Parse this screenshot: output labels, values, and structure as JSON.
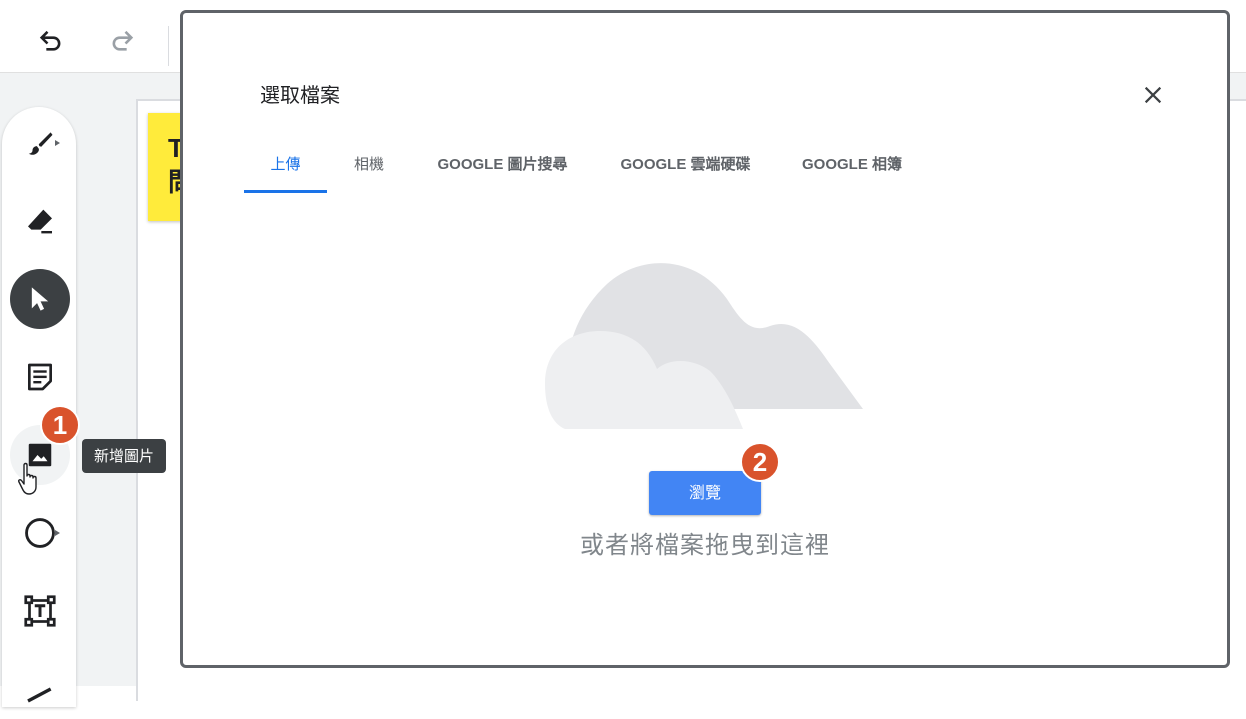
{
  "toolbar": {
    "undo_icon": "undo-icon",
    "redo_icon": "redo-icon"
  },
  "canvas": {
    "sticky_text_line1": "T",
    "sticky_text_line2": "問"
  },
  "tools": [
    {
      "name": "pen-icon"
    },
    {
      "name": "eraser-icon"
    },
    {
      "name": "select-cursor-icon",
      "active": true
    },
    {
      "name": "sticky-note-icon"
    },
    {
      "name": "image-icon"
    },
    {
      "name": "circle-shape-icon"
    },
    {
      "name": "text-box-icon"
    },
    {
      "name": "laser-pointer-icon"
    }
  ],
  "tooltip": {
    "label": "新增圖片"
  },
  "annotations": {
    "step1": "1",
    "step2": "2",
    "color": "#d9532c"
  },
  "dialog": {
    "title": "選取檔案",
    "tabs": [
      {
        "label": "上傳",
        "selected": true
      },
      {
        "label": "相機"
      },
      {
        "label": "GOOGLE 圖片搜尋"
      },
      {
        "label": "GOOGLE 雲端硬碟"
      },
      {
        "label": "GOOGLE 相簿"
      }
    ],
    "browse_label": "瀏覽",
    "drop_hint": "或者將檔案拖曳到這裡"
  },
  "colors": {
    "accent": "#1a73e8",
    "button": "#4285f4",
    "sticky": "#ffeb3b"
  }
}
